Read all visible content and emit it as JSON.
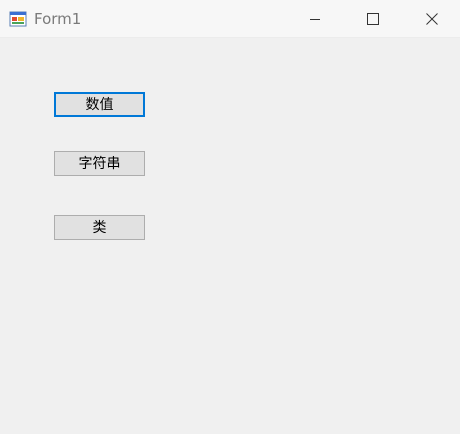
{
  "window": {
    "title": "Form1",
    "icon": "winforms-app-icon"
  },
  "titlebar": {
    "minimize_icon": "minimize-icon",
    "maximize_icon": "maximize-icon",
    "close_icon": "close-icon"
  },
  "buttons": [
    {
      "label": "数值",
      "focused": true
    },
    {
      "label": "字符串",
      "focused": false
    },
    {
      "label": "类",
      "focused": false
    }
  ],
  "colors": {
    "focus_border": "#0078d7",
    "button_face": "#e1e1e1",
    "form_background": "#f0f0f0"
  }
}
